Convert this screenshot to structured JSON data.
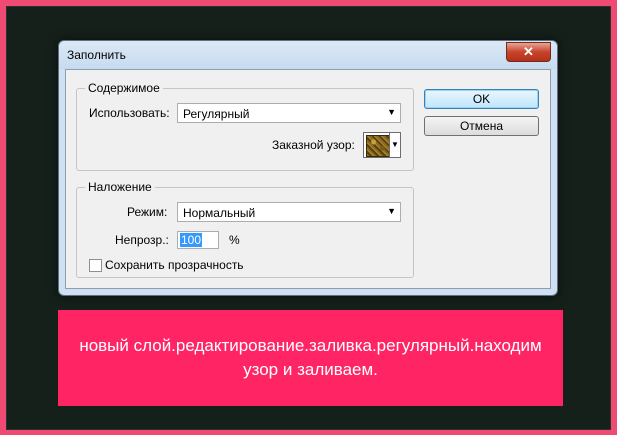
{
  "dialog": {
    "title": "Заполнить",
    "close_label": "✕",
    "content_group": {
      "legend": "Содержимое",
      "use_label": "Использовать:",
      "use_value": "Регулярный",
      "pattern_label": "Заказной узор:"
    },
    "blending_group": {
      "legend": "Наложение",
      "mode_label": "Режим:",
      "mode_value": "Нормальный",
      "opacity_label": "Непрозр.:",
      "opacity_value": "100",
      "opacity_unit": "%",
      "preserve_transparency_label": "Сохранить прозрачность",
      "preserve_transparency_checked": false
    },
    "ok_label": "OK",
    "cancel_label": "Отмена"
  },
  "caption": {
    "text": "новый слой.редактирование.заливка.регулярный.находим узор и заливаем."
  },
  "colors": {
    "outer_border": "#ee4a73",
    "frame_background": "#15201b",
    "caption_background": "#ff2565",
    "caption_text": "#ffffff"
  }
}
